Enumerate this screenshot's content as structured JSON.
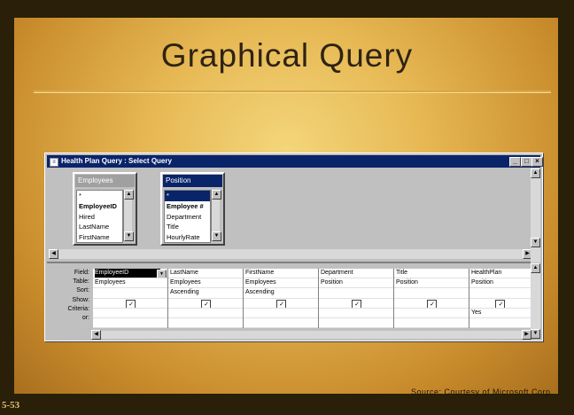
{
  "slide": {
    "title": "Graphical Query",
    "source": "Source: Courtesy of Microsoft Corp.",
    "number": "5-53"
  },
  "window": {
    "title": "Health Plan Query : Select Query",
    "buttons": {
      "minimize": "_",
      "maximize": "□",
      "close": "×"
    }
  },
  "tables": [
    {
      "name": "Employees",
      "active": false,
      "fields": [
        "*",
        "EmployeeID",
        "Hired",
        "LastName",
        "FirstName"
      ],
      "bold_field": "EmployeeID"
    },
    {
      "name": "Position",
      "active": true,
      "fields": [
        "*",
        "Employee #",
        "Department",
        "Title",
        "HourlyRate"
      ],
      "bold_field": "Employee #"
    }
  ],
  "relationship": {
    "one": "1",
    "many": "∞"
  },
  "grid": {
    "row_labels": [
      "Field:",
      "Table:",
      "Sort:",
      "Show:",
      "Criteria:",
      "or:"
    ],
    "columns": [
      {
        "field": "EmployeeID",
        "table": "Employees",
        "sort": "",
        "show": true,
        "criteria": "",
        "or": "",
        "selected": true
      },
      {
        "field": "LastName",
        "table": "Employees",
        "sort": "Ascending",
        "show": true,
        "criteria": "",
        "or": ""
      },
      {
        "field": "FirstName",
        "table": "Employees",
        "sort": "Ascending",
        "show": true,
        "criteria": "",
        "or": ""
      },
      {
        "field": "Department",
        "table": "Position",
        "sort": "",
        "show": true,
        "criteria": "",
        "or": ""
      },
      {
        "field": "Title",
        "table": "Position",
        "sort": "",
        "show": true,
        "criteria": "",
        "or": ""
      },
      {
        "field": "HealthPlan",
        "table": "Position",
        "sort": "",
        "show": true,
        "criteria": "Yes",
        "or": ""
      }
    ]
  },
  "icons": {
    "check": "✓",
    "dropdown": "▼",
    "up": "▲",
    "down": "▼",
    "left": "◀",
    "right": "▶"
  }
}
